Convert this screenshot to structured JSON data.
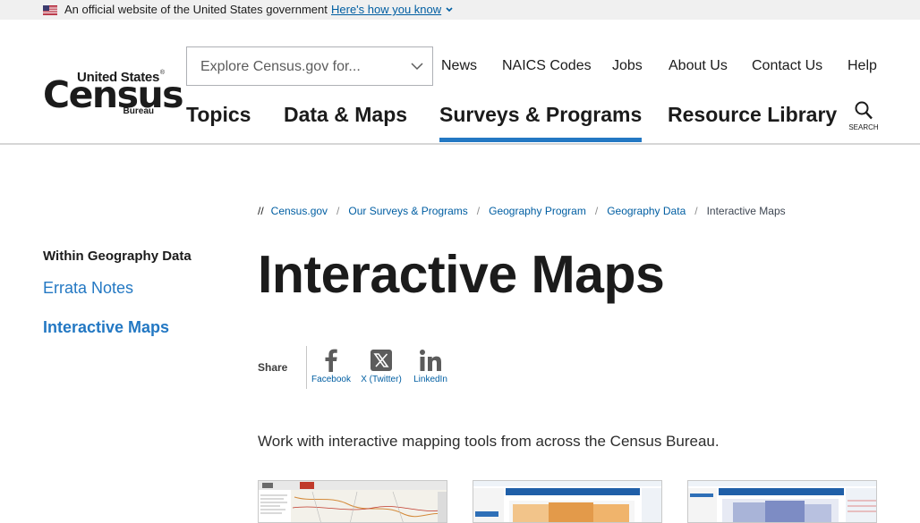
{
  "gov_banner": {
    "official_text": "An official website of the United States government",
    "how_you_know": "Here's how you know"
  },
  "logo": {
    "line1": "United States",
    "line2": "Census",
    "line3": "Bureau",
    "reg_mark": "®"
  },
  "search": {
    "placeholder": "Explore Census.gov for...",
    "button_label": "SEARCH"
  },
  "utility_nav": [
    "News",
    "NAICS Codes",
    "Jobs",
    "About Us",
    "Contact Us",
    "Help"
  ],
  "main_nav": {
    "items": [
      "Topics",
      "Data & Maps",
      "Surveys & Programs",
      "Resource Library"
    ],
    "active": "Surveys & Programs"
  },
  "breadcrumb": {
    "prefix": "//",
    "items": [
      "Census.gov",
      "Our Surveys & Programs",
      "Geography Program",
      "Geography Data"
    ],
    "current": "Interactive Maps"
  },
  "side_nav": {
    "heading": "Within Geography Data",
    "items": [
      "Errata Notes",
      "Interactive Maps"
    ]
  },
  "page_title": "Interactive Maps",
  "share": {
    "label": "Share",
    "items": [
      "Facebook",
      "X (Twitter)",
      "LinkedIn"
    ]
  },
  "intro": "Work with interactive mapping tools from across the Census Bureau.",
  "colors": {
    "link": "#005ea2",
    "accent": "#2378c3",
    "banner_bg": "#f0f0f0"
  }
}
